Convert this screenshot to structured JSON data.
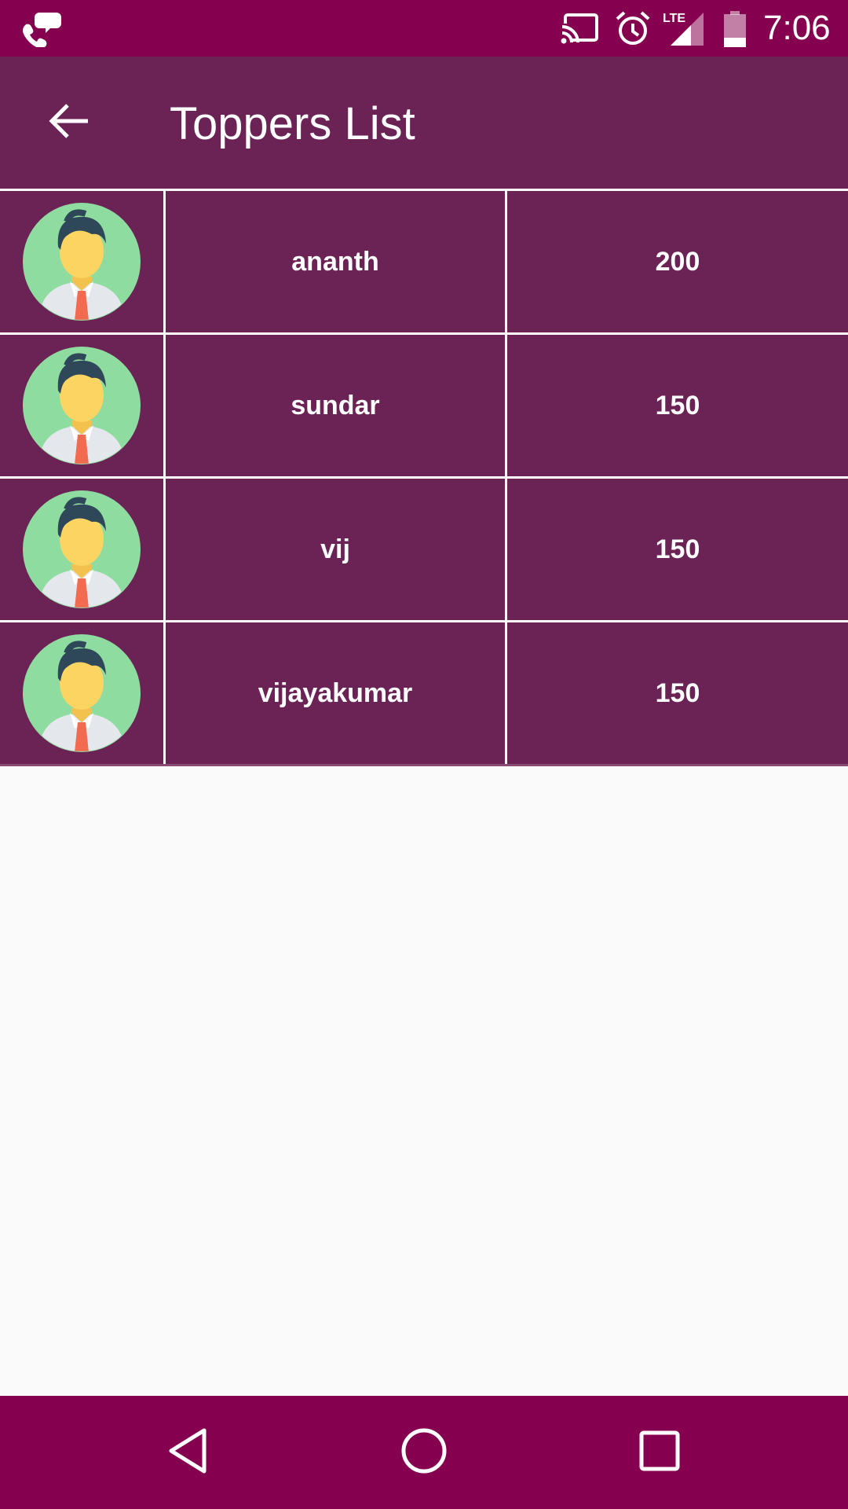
{
  "status_bar": {
    "time": "7:06",
    "network_label": "LTE",
    "icons": [
      "phone-chat-icon",
      "cast-icon",
      "alarm-icon",
      "signal-icon",
      "battery-icon"
    ]
  },
  "app_bar": {
    "title": "Toppers List",
    "back_icon": "arrow-left-icon"
  },
  "toppers": [
    {
      "name": "ananth",
      "score": "200",
      "avatar_icon": "user-avatar-icon"
    },
    {
      "name": "sundar",
      "score": "150",
      "avatar_icon": "user-avatar-icon"
    },
    {
      "name": "vij",
      "score": "150",
      "avatar_icon": "user-avatar-icon"
    },
    {
      "name": "vijayakumar",
      "score": "150",
      "avatar_icon": "user-avatar-icon"
    }
  ],
  "nav_bar": {
    "icons": [
      "nav-back-icon",
      "nav-home-icon",
      "nav-recent-icon"
    ]
  },
  "colors": {
    "status_bar": "#85004f",
    "app_bar": "#6b2254",
    "row_bg": "#6b2254",
    "divider": "#ffffff",
    "background": "#fafafa",
    "avatar_bg": "#8fdca0"
  }
}
